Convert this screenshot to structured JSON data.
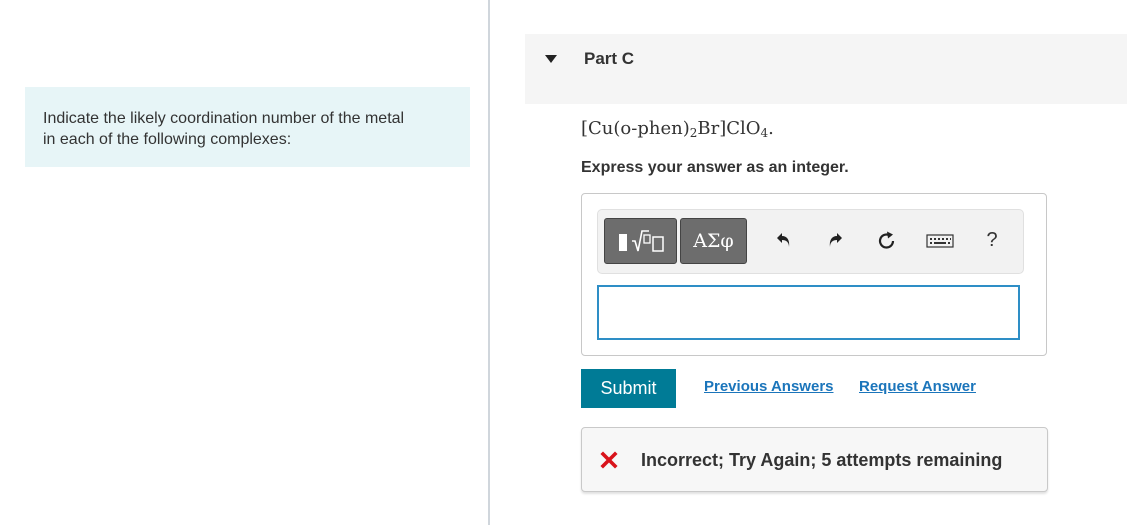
{
  "instructions": {
    "line1": "Indicate the likely coordination number of the metal",
    "line2": "in each of the following complexes:"
  },
  "part": {
    "title": "Part C",
    "formula": {
      "a": "[Cu(o-phen)",
      "sub1": "2",
      "b": "Br]ClO",
      "sub2": "4",
      "c": "."
    },
    "prompt": "Express your answer as an integer."
  },
  "toolbar": {
    "greek_label": "ΑΣφ",
    "help_label": "?",
    "icons": [
      "templates-icon",
      "undo-icon",
      "redo-icon",
      "reset-icon",
      "keyboard-icon"
    ]
  },
  "answer": {
    "value": "",
    "placeholder": ""
  },
  "actions": {
    "submit_label": "Submit",
    "previous_answers_label": "Previous Answers",
    "request_answer_label": "Request Answer"
  },
  "feedback": {
    "text": "Incorrect; Try Again; 5 attempts remaining",
    "icon": "x-icon",
    "icon_color": "#d9131b"
  },
  "colors": {
    "accent": "#007b96",
    "link": "#1b75bb",
    "input_border": "#2e8ec6",
    "instructions_bg": "#e7f5f7"
  }
}
